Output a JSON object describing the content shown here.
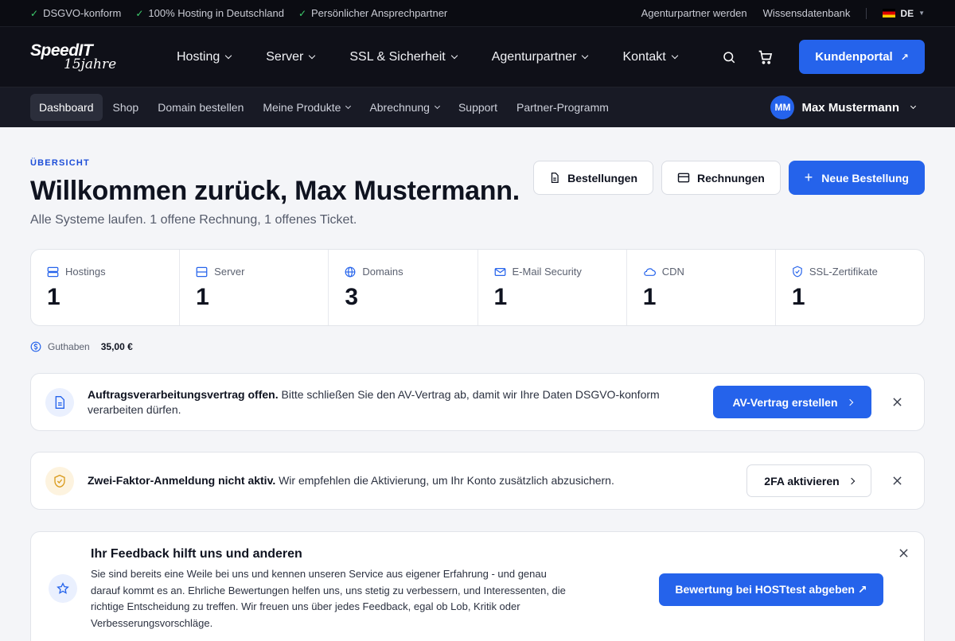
{
  "topbar": {
    "usps": [
      "DSGVO-konform",
      "100% Hosting in Deutschland",
      "Persönlicher Ansprechpartner"
    ],
    "links": [
      "Agenturpartner werden",
      "Wissensdatenbank"
    ],
    "language": "DE"
  },
  "logo": {
    "name": "SpeedIT",
    "tagline": "15jahre"
  },
  "mainnav": {
    "items": [
      "Hosting",
      "Server",
      "SSL & Sicherheit",
      "Agenturpartner",
      "Kontakt"
    ],
    "portal_label": "Kundenportal"
  },
  "subnav": {
    "items": [
      "Dashboard",
      "Shop",
      "Domain bestellen",
      "Meine Produkte",
      "Abrechnung",
      "Support",
      "Partner-Programm"
    ],
    "user_initials": "MM",
    "user_name": "Max Mustermann"
  },
  "header": {
    "eyebrow": "ÜBERSICHT",
    "title": "Willkommen zurück, Max Mustermann.",
    "subtitle": "Alle Systeme laufen. 1 offene Rechnung, 1 offenes Ticket.",
    "actions": {
      "orders": "Bestellungen",
      "invoices": "Rechnungen",
      "new_order": "Neue Bestellung"
    }
  },
  "stats": [
    {
      "label": "Hostings",
      "value": "1",
      "icon": "server-stack-icon"
    },
    {
      "label": "Server",
      "value": "1",
      "icon": "server-icon"
    },
    {
      "label": "Domains",
      "value": "3",
      "icon": "globe-icon"
    },
    {
      "label": "E-Mail Security",
      "value": "1",
      "icon": "mail-icon"
    },
    {
      "label": "CDN",
      "value": "1",
      "icon": "cloud-icon"
    },
    {
      "label": "SSL-Zertifikate",
      "value": "1",
      "icon": "shield-check-icon"
    }
  ],
  "balance": {
    "label": "Guthaben",
    "value": "35,00 €"
  },
  "notices": {
    "av": {
      "title": "Auftragsverarbeitungsvertrag offen.",
      "text": "Bitte schließen Sie den AV-Vertrag ab, damit wir Ihre Daten DSGVO-konform verarbeiten dürfen.",
      "button": "AV-Vertrag erstellen"
    },
    "twofa": {
      "title": "Zwei-Faktor-Anmeldung nicht aktiv.",
      "text": "Wir empfehlen die Aktivierung, um Ihr Konto zusätzlich abzusichern.",
      "button": "2FA aktivieren"
    }
  },
  "feedback": {
    "title": "Ihr Feedback hilft uns und anderen",
    "text": "Sie sind bereits eine Weile bei uns und kennen unseren Service aus eigener Erfahrung - und genau darauf kommt es an. Ehrliche Bewertungen helfen uns, uns stetig zu verbessern, und Interessenten, die richtige Entscheidung zu treffen. Wir freuen uns über jedes Feedback, egal ob Lob, Kritik oder Verbesserungsvorschläge.",
    "button": "Bewertung bei HOSTtest abgeben ↗"
  },
  "colors": {
    "accent": "#2563eb",
    "dark": "#0f1018",
    "success": "#3ecf6e",
    "warning": "#d99a1c"
  }
}
